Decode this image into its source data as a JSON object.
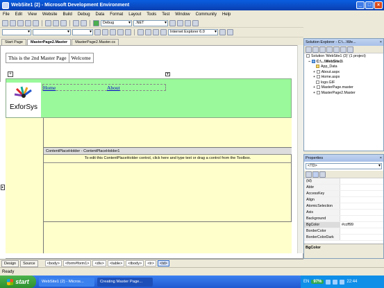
{
  "window": {
    "title": "WebSite1 (2) - Microsoft Development Environment"
  },
  "menu": [
    "File",
    "Edit",
    "View",
    "Website",
    "Build",
    "Debug",
    "Data",
    "Format",
    "Layout",
    "Tools",
    "Test",
    "Window",
    "Community",
    "Help"
  ],
  "toolbar": {
    "config": "Debug",
    "platform": ".NET",
    "target_browser": "Internet Explorer 6.0"
  },
  "tabs": [
    "Start Page",
    "MasterPage2.Master",
    "MasterPage2.Master.cs"
  ],
  "page": {
    "master_cells": [
      "This is the 2nd Master Page",
      "Welcome"
    ],
    "logo_text": "ExforSys",
    "nav_links": [
      "Home",
      "About"
    ],
    "cph_header": "ContentPlaceHolder - ContentPlaceHolder1",
    "cph_text": "To edit this ContentPlaceHolder control, click here and type text or drag a control from the Toolbox."
  },
  "view_buttons": [
    "Design",
    "Source"
  ],
  "tag_path": [
    "<body>",
    "<form#form1>",
    "<div>",
    "<table>",
    "<tbody>",
    "<tr>",
    "<td>"
  ],
  "solution_explorer": {
    "title": "Solution Explorer - C:\\...\\We...",
    "items": [
      "Solution 'WebSite1 (2)' (1 project)",
      "C:\\...\\WebSite1\\",
      "App_Data",
      "About.aspx",
      "Home.aspx",
      "logo.GIF",
      "MasterPage.master",
      "MasterPage2.Master"
    ]
  },
  "properties": {
    "title": "Properties",
    "selector": "<TD>",
    "rows": [
      {
        "name": "(Id)",
        "value": ""
      },
      {
        "name": "Abbr",
        "value": ""
      },
      {
        "name": "AccessKey",
        "value": ""
      },
      {
        "name": "Align",
        "value": ""
      },
      {
        "name": "AtomicSelection",
        "value": ""
      },
      {
        "name": "Axis",
        "value": ""
      },
      {
        "name": "Background",
        "value": ""
      },
      {
        "name": "BgColor",
        "value": "#ccff99"
      },
      {
        "name": "BorderColor",
        "value": ""
      },
      {
        "name": "BorderColorDark",
        "value": ""
      }
    ],
    "description": "BgColor"
  },
  "status": "Ready",
  "taskbar": {
    "start": "start",
    "tasks": [
      "WebSite1 (2) - Micros...",
      "Creating Master Page..."
    ],
    "lang": "EN",
    "battery": "97%",
    "clock": "22:44"
  },
  "colors": {
    "green": "#9af99a",
    "yellow": "#ffffcc"
  }
}
